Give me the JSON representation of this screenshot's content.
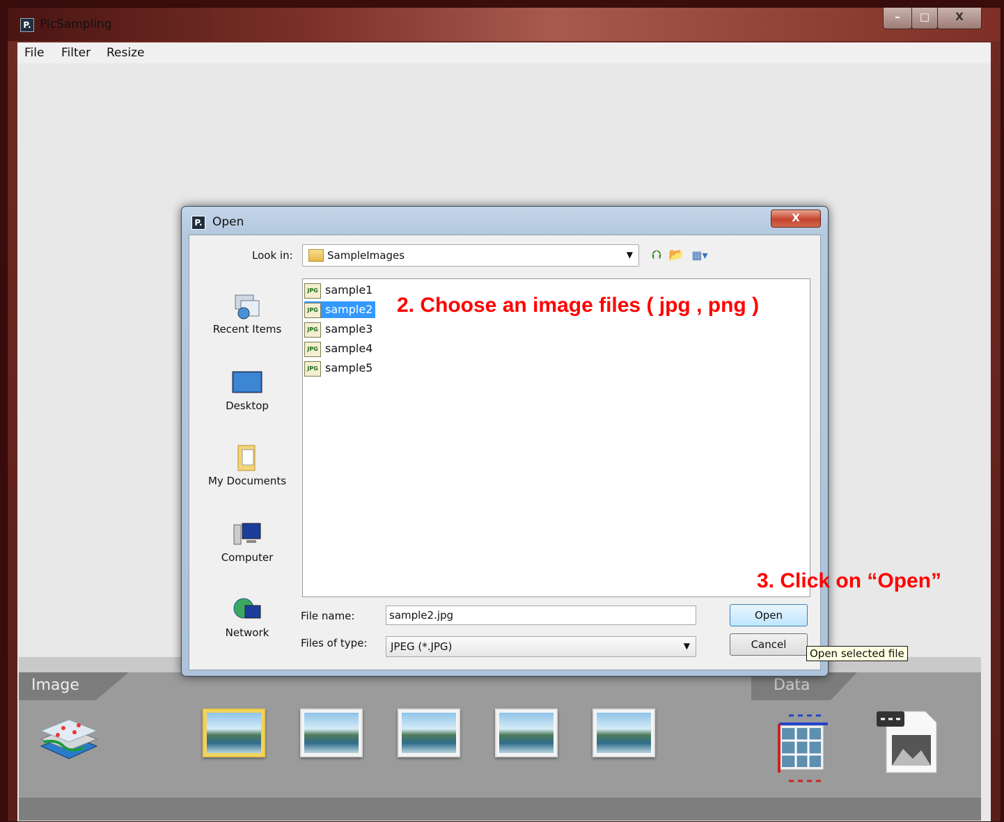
{
  "window": {
    "title": "PicSampling",
    "icon_letter": "P.",
    "controls": {
      "minimize": "–",
      "maximize": "□",
      "close": "X"
    }
  },
  "menu": {
    "items": [
      "File",
      "Filter",
      "Resize"
    ]
  },
  "bottom_panel": {
    "image_section_label": "Image",
    "data_section_label": "Data",
    "thumbnails_count_selected_index": 0
  },
  "dialog": {
    "title": "Open",
    "icon_letter": "P.",
    "close_label": "X",
    "look_in": {
      "label": "Look in:",
      "value": "SampleImages"
    },
    "toolbar_icons": [
      "up-one-level",
      "create-new-folder",
      "view-menu"
    ],
    "places": [
      {
        "label": "Recent Items",
        "icon": "recent-items-icon"
      },
      {
        "label": "Desktop",
        "icon": "desktop-icon"
      },
      {
        "label": "My Documents",
        "icon": "documents-icon"
      },
      {
        "label": "Computer",
        "icon": "computer-icon"
      },
      {
        "label": "Network",
        "icon": "network-icon"
      }
    ],
    "files": [
      {
        "name": "sample1",
        "selected": false,
        "icon_text": "JPG"
      },
      {
        "name": "sample2",
        "selected": true,
        "icon_text": "JPG"
      },
      {
        "name": "sample3",
        "selected": false,
        "icon_text": "JPG"
      },
      {
        "name": "sample4",
        "selected": false,
        "icon_text": "JPG"
      },
      {
        "name": "sample5",
        "selected": false,
        "icon_text": "JPG"
      }
    ],
    "file_name": {
      "label": "File name:",
      "value": "sample2.jpg"
    },
    "files_of_type": {
      "label": "Files of type:",
      "value": "JPEG (*.JPG)"
    },
    "open_button": "Open",
    "cancel_button": "Cancel",
    "tooltip": "Open selected file"
  },
  "annotations": {
    "step2": "2.  Choose an image files ( jpg , png )",
    "step3": "3.  Click on “Open”",
    "color": "#ff0000"
  }
}
